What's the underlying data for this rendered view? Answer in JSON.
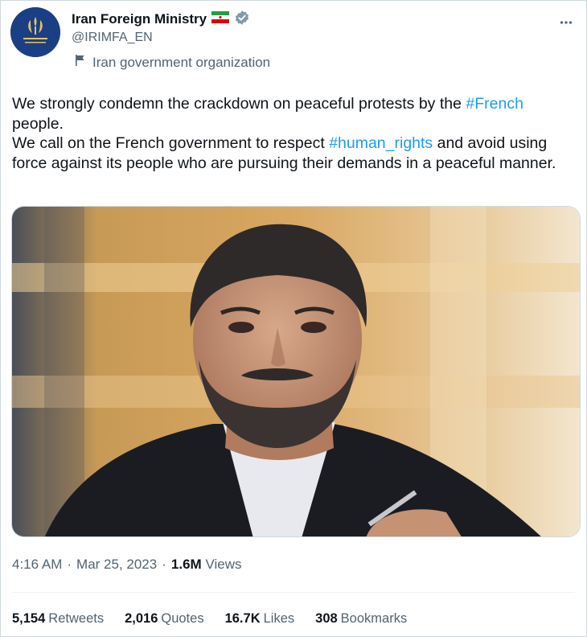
{
  "account": {
    "display_name": "Iran Foreign Ministry",
    "handle": "@IRIMFA_EN",
    "affiliation": "Iran government organization",
    "avatar_caption": "Islamic Republic of Iran · Ministry of Foreign Affairs",
    "verified_icon": "verified-badge-icon",
    "flag_icon": "iran-flag-icon"
  },
  "tweet": {
    "para1_prefix": "We strongly condemn the crackdown on peaceful protests by the",
    "hashtag1": "#French",
    "para1_suffix": "people.",
    "para2_prefix": "We call on the French government to respect",
    "hashtag2": "#human_rights",
    "para2_suffix": "and avoid using force against its people who are pursuing their demands in a peaceful manner."
  },
  "meta": {
    "time": "4:16 AM",
    "date": "Mar 25, 2023",
    "views_count": "1.6M",
    "views_label": "Views"
  },
  "stats": {
    "retweets_count": "5,154",
    "retweets_label": "Retweets",
    "quotes_count": "2,016",
    "quotes_label": "Quotes",
    "likes_count": "16.7K",
    "likes_label": "Likes",
    "bookmarks_count": "308",
    "bookmarks_label": "Bookmarks"
  },
  "colors": {
    "link": "#1d9bf0",
    "secondary_text": "#536471",
    "verified_badge": "#829aab"
  }
}
